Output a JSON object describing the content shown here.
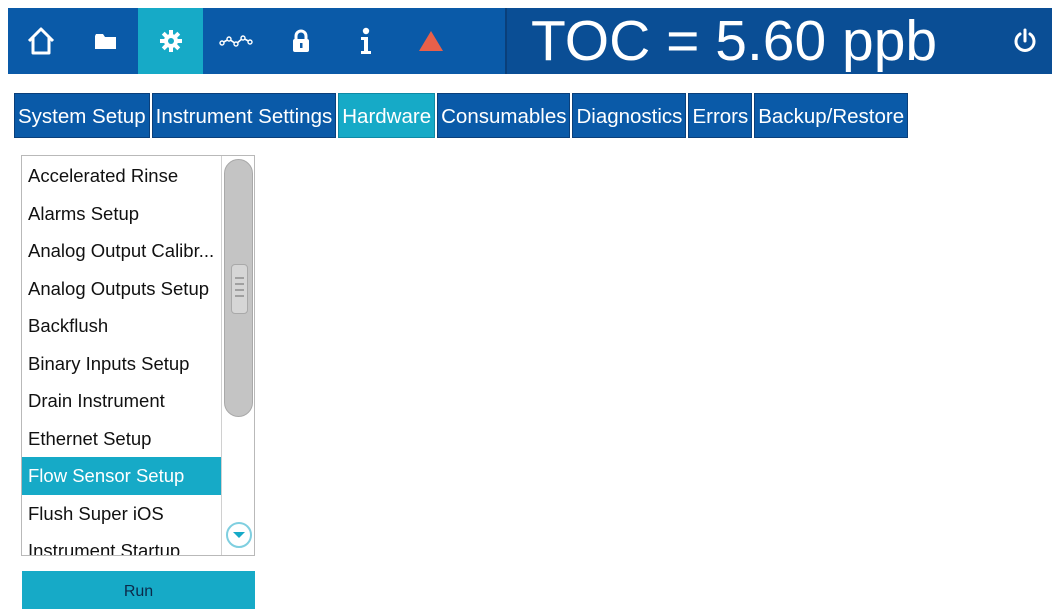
{
  "navbar": {
    "buttons": [
      {
        "id": "home",
        "icon": "home-icon",
        "active": false
      },
      {
        "id": "files",
        "icon": "folder-icon",
        "active": false
      },
      {
        "id": "settings",
        "icon": "gear-icon",
        "active": true
      },
      {
        "id": "trend",
        "icon": "trend-icon",
        "active": false
      },
      {
        "id": "lock",
        "icon": "lock-icon",
        "active": false
      },
      {
        "id": "info",
        "icon": "info-icon",
        "active": false
      },
      {
        "id": "alarm",
        "icon": "warning-triangle-icon",
        "active": false
      }
    ],
    "readout": "TOC = 5.60 ppb",
    "power_icon": "power-icon",
    "colors": {
      "bar": "#0a5aa8",
      "active": "#16aac7",
      "alarm": "#e8604a"
    }
  },
  "tabs": [
    {
      "label": "System Setup",
      "active": false
    },
    {
      "label": "Instrument Settings",
      "active": false
    },
    {
      "label": "Hardware",
      "active": true
    },
    {
      "label": "Consumables",
      "active": false
    },
    {
      "label": "Diagnostics",
      "active": false
    },
    {
      "label": "Errors",
      "active": false
    },
    {
      "label": "Backup/Restore",
      "active": false
    }
  ],
  "list": {
    "items": [
      "Accelerated Rinse",
      "Alarms Setup",
      "Analog Output Calibr...",
      "Analog Outputs Setup",
      "Backflush",
      "Binary Inputs Setup",
      "Drain Instrument",
      "Ethernet Setup",
      "Flow Sensor Setup",
      "Flush Super iOS",
      "Instrument Startup"
    ],
    "selected": "Flow Sensor Setup",
    "scroll_down_icon": "chevron-down-icon"
  },
  "run_button": {
    "label": "Run"
  }
}
